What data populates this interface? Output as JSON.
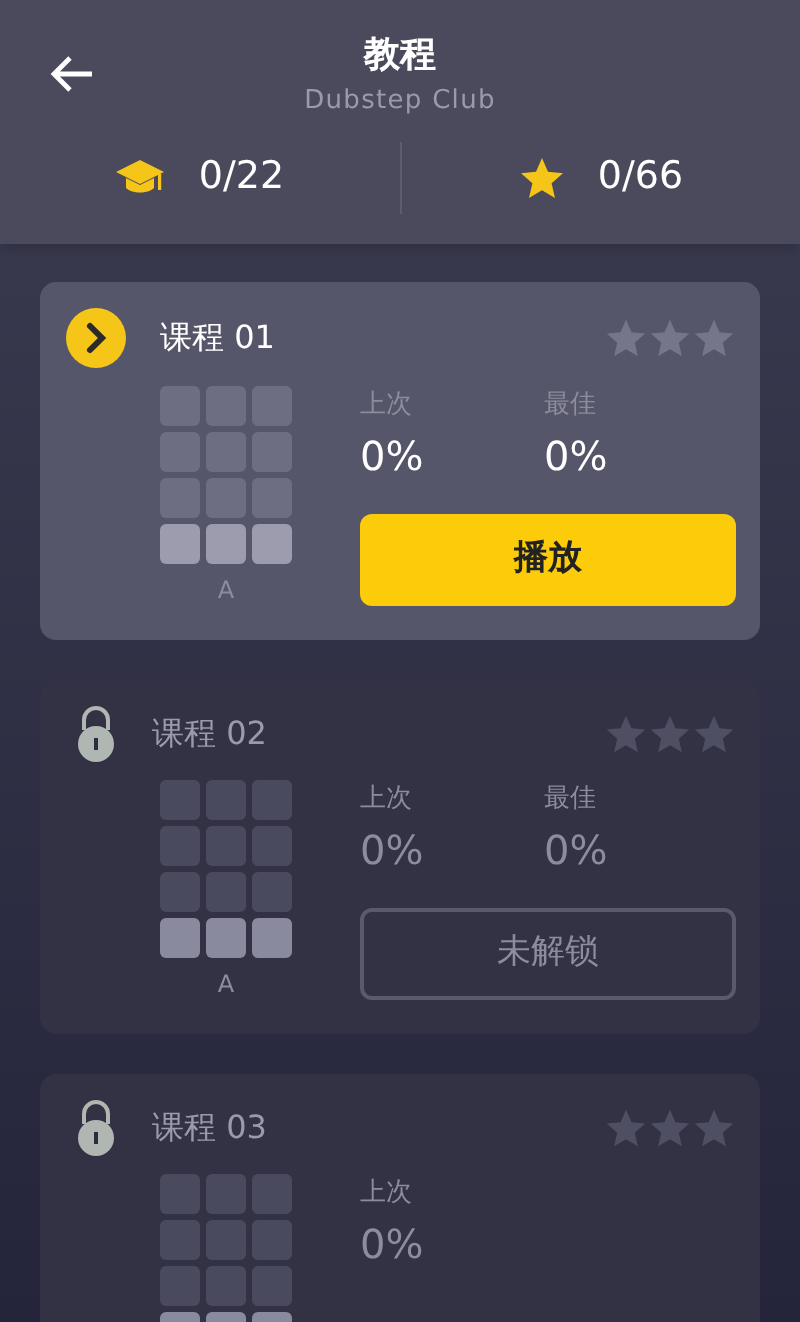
{
  "header": {
    "title": "教程",
    "subtitle": "Dubstep Club"
  },
  "stats": [
    {
      "kind": "lessons",
      "value": "0/22"
    },
    {
      "kind": "stars",
      "value": "0/66"
    }
  ],
  "lessons": [
    {
      "title": "课程 01",
      "locked": false,
      "stars": 0,
      "grade": "A",
      "last_label": "上次",
      "last": "0%",
      "best_label": "最佳",
      "best": "0%",
      "button": "播放"
    },
    {
      "title": "课程 02",
      "locked": true,
      "stars": 0,
      "grade": "A",
      "last_label": "上次",
      "last": "0%",
      "best_label": "最佳",
      "best": "0%",
      "button": "未解锁"
    },
    {
      "title": "课程 03",
      "locked": true,
      "stars": 0,
      "last_label": "上次",
      "last": "0%"
    }
  ]
}
